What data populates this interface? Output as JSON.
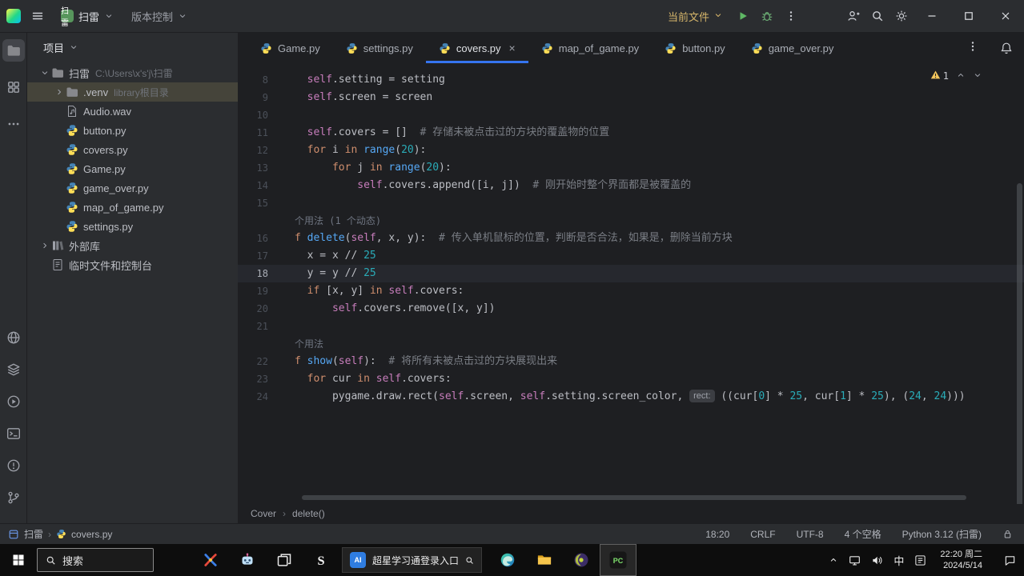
{
  "titlebar": {
    "project_name": "扫雷",
    "vcs_label": "版本控制",
    "run_config_label": "当前文件"
  },
  "activity_bar": {
    "active": "project",
    "top": [
      "project",
      "structure",
      "more"
    ],
    "bottom": [
      "packages",
      "services",
      "run",
      "terminal",
      "problems",
      "version-control"
    ]
  },
  "project_panel": {
    "header": "项目",
    "tree": [
      {
        "label": "扫雷",
        "suffix": "C:\\Users\\x's'j\\扫雷",
        "icon": "folder",
        "chevron": "down",
        "level": 0
      },
      {
        "label": ".venv",
        "suffix": "library根目录",
        "icon": "folder",
        "chevron": "right",
        "level": 1,
        "selected": true
      },
      {
        "label": "Audio.wav",
        "icon": "audio",
        "level": 1
      },
      {
        "label": "button.py",
        "icon": "python",
        "level": 1
      },
      {
        "label": "covers.py",
        "icon": "python",
        "level": 1
      },
      {
        "label": "Game.py",
        "icon": "python",
        "level": 1
      },
      {
        "label": "game_over.py",
        "icon": "python",
        "level": 1
      },
      {
        "label": "map_of_game.py",
        "icon": "python",
        "level": 1
      },
      {
        "label": "settings.py",
        "icon": "python",
        "level": 1
      },
      {
        "label": "外部库",
        "icon": "lib",
        "chevron": "right",
        "level": 0
      },
      {
        "label": "临时文件和控制台",
        "icon": "scratch",
        "level": 0
      }
    ]
  },
  "tabs": {
    "items": [
      {
        "label": "Game.py"
      },
      {
        "label": "settings.py"
      },
      {
        "label": "covers.py",
        "active": true
      },
      {
        "label": "map_of_game.py"
      },
      {
        "label": "button.py"
      },
      {
        "label": "game_over.py"
      }
    ]
  },
  "editor": {
    "warning_count": "1",
    "breadcrumbs": [
      "Cover",
      "delete()"
    ],
    "rows": [
      {
        "n": "8",
        "t": [
          [
            "  ",
            "d"
          ],
          [
            "self",
            "sf"
          ],
          [
            ".setting = setting",
            "d"
          ]
        ]
      },
      {
        "n": "9",
        "t": [
          [
            "  ",
            "d"
          ],
          [
            "self",
            "sf"
          ],
          [
            ".screen = screen",
            "d"
          ]
        ]
      },
      {
        "n": "10",
        "t": []
      },
      {
        "n": "11",
        "t": [
          [
            "  ",
            "d"
          ],
          [
            "self",
            "sf"
          ],
          [
            ".covers = []",
            "d"
          ],
          [
            "  # 存储未被点击过的方块的覆盖物的位置",
            "cm"
          ]
        ]
      },
      {
        "n": "12",
        "t": [
          [
            "  ",
            "d"
          ],
          [
            "for",
            "kw"
          ],
          [
            " i ",
            "d"
          ],
          [
            "in",
            "kw"
          ],
          [
            " ",
            "d"
          ],
          [
            "range",
            "fn"
          ],
          [
            "(",
            "d"
          ],
          [
            "20",
            "nm"
          ],
          [
            "):",
            "d"
          ]
        ]
      },
      {
        "n": "13",
        "t": [
          [
            "      ",
            "d"
          ],
          [
            "for",
            "kw"
          ],
          [
            " j ",
            "d"
          ],
          [
            "in",
            "kw"
          ],
          [
            " ",
            "d"
          ],
          [
            "range",
            "fn"
          ],
          [
            "(",
            "d"
          ],
          [
            "20",
            "nm"
          ],
          [
            "):",
            "d"
          ]
        ]
      },
      {
        "n": "14",
        "t": [
          [
            "          ",
            "d"
          ],
          [
            "self",
            "sf"
          ],
          [
            ".covers.append([i, j])",
            "d"
          ],
          [
            "  # 刚开始时整个界面都是被覆盖的",
            "cm"
          ]
        ]
      },
      {
        "n": "15",
        "t": []
      },
      {
        "hint": true,
        "t": [
          [
            "个用法 (1 个动态)",
            "hint"
          ]
        ]
      },
      {
        "n": "16",
        "t": [
          [
            "f ",
            "kw"
          ],
          [
            "delete",
            "fn"
          ],
          [
            "(",
            "d"
          ],
          [
            "self",
            "sf"
          ],
          [
            ", x, y):",
            "d"
          ],
          [
            "  # 传入单机鼠标的位置，判断是否合法，如果是，删除当前方块",
            "cm"
          ]
        ]
      },
      {
        "n": "17",
        "t": [
          [
            "  x = x // ",
            "d"
          ],
          [
            "25",
            "nm"
          ]
        ]
      },
      {
        "n": "18",
        "current": true,
        "t": [
          [
            "  y = y // ",
            "d"
          ],
          [
            "25",
            "nm"
          ]
        ]
      },
      {
        "n": "19",
        "t": [
          [
            "  ",
            "d"
          ],
          [
            "if",
            "kw"
          ],
          [
            " [x, y] ",
            "d"
          ],
          [
            "in",
            "kw"
          ],
          [
            " ",
            "d"
          ],
          [
            "self",
            "sf"
          ],
          [
            ".covers:",
            "d"
          ]
        ]
      },
      {
        "n": "20",
        "t": [
          [
            "      ",
            "d"
          ],
          [
            "self",
            "sf"
          ],
          [
            ".covers.remove([x, y])",
            "d"
          ]
        ]
      },
      {
        "n": "21",
        "t": []
      },
      {
        "hint": true,
        "t": [
          [
            "个用法",
            "hint"
          ]
        ]
      },
      {
        "n": "22",
        "t": [
          [
            "f ",
            "kw"
          ],
          [
            "show",
            "fn"
          ],
          [
            "(",
            "d"
          ],
          [
            "self",
            "sf"
          ],
          [
            "):",
            "d"
          ],
          [
            "  # 将所有未被点击过的方块展现出来",
            "cm"
          ]
        ]
      },
      {
        "n": "23",
        "t": [
          [
            "  ",
            "d"
          ],
          [
            "for",
            "kw"
          ],
          [
            " cur ",
            "d"
          ],
          [
            "in",
            "kw"
          ],
          [
            " ",
            "d"
          ],
          [
            "self",
            "sf"
          ],
          [
            ".covers:",
            "d"
          ]
        ]
      },
      {
        "n": "24",
        "t": [
          [
            "      pygame.draw.rect(",
            "d"
          ],
          [
            "self",
            "sf"
          ],
          [
            ".screen, ",
            "d"
          ],
          [
            "self",
            "sf"
          ],
          [
            ".setting.screen_color, ",
            "d"
          ],
          [
            "rect:",
            "ph"
          ],
          [
            " ((cur[",
            "d"
          ],
          [
            "0",
            "nm"
          ],
          [
            "] * ",
            "d"
          ],
          [
            "25",
            "nm"
          ],
          [
            ", cur[",
            "d"
          ],
          [
            "1",
            "nm"
          ],
          [
            "] * ",
            "d"
          ],
          [
            "25",
            "nm"
          ],
          [
            "), (",
            "d"
          ],
          [
            "24",
            "nm"
          ],
          [
            ", ",
            "d"
          ],
          [
            "24",
            "nm"
          ],
          [
            ")))",
            "d"
          ]
        ]
      }
    ]
  },
  "status_bar": {
    "project": "扫雷",
    "file": "covers.py",
    "caret": "18:20",
    "line_ending": "CRLF",
    "encoding": "UTF-8",
    "indent": "4 个空格",
    "interpreter": "Python 3.12 (扫雷)"
  },
  "taskbar": {
    "search_label": "搜索",
    "apps": [
      "paint",
      "assistant",
      "task-view",
      "s-logo"
    ],
    "pinned_app_badge": "AI",
    "pinned_app_label": "超星学习通登录入口",
    "right_apps": [
      "edge",
      "explorer",
      "eclipse",
      "pycharm"
    ],
    "ime_lang": "中",
    "time": "22:20 周二",
    "date": "2024/5/14"
  },
  "colors": {
    "accent_blue": "#3574f0",
    "editor_bg": "#1e1f22",
    "panel_bg": "#2b2d30",
    "warning_yellow": "#f2c55c",
    "run_green": "#5fb865"
  }
}
